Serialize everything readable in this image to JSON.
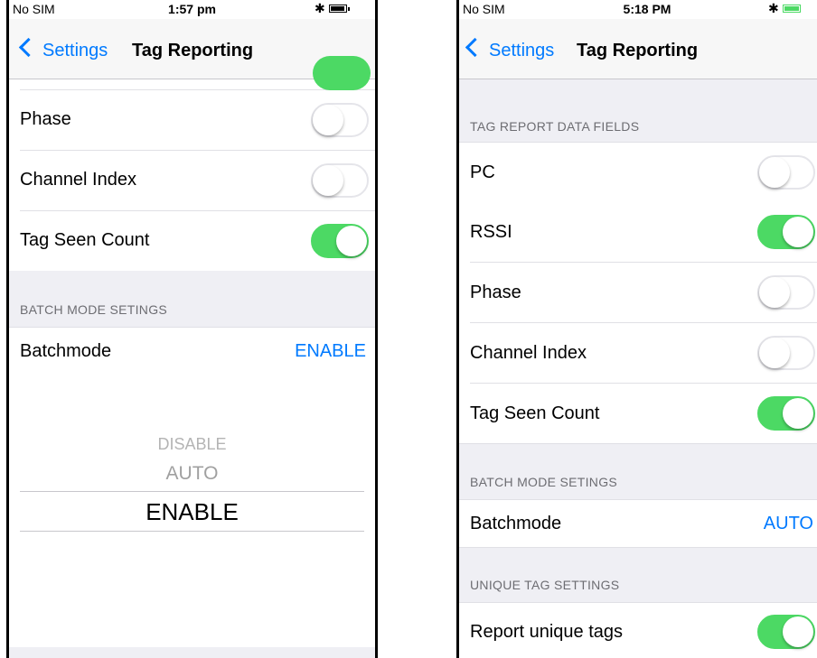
{
  "left_screen": {
    "status": {
      "carrier": "No SIM",
      "time": "1:57 pm",
      "bluetooth_icon": "bluetooth-icon",
      "battery_icon": "battery-icon"
    },
    "nav": {
      "back_label": "Settings",
      "title": "Tag Reporting"
    },
    "rows": [
      {
        "label": "Phase",
        "toggle": "off"
      },
      {
        "label": "Channel Index",
        "toggle": "off"
      },
      {
        "label": "Tag Seen Count",
        "toggle": "on"
      }
    ],
    "batch_section_header": "BATCH MODE SETINGS",
    "batchmode": {
      "label": "Batchmode",
      "value": "ENABLE"
    },
    "picker": {
      "options": [
        "DISABLE",
        "AUTO",
        "ENABLE"
      ],
      "selected": "ENABLE"
    }
  },
  "right_screen": {
    "status": {
      "carrier": "No SIM",
      "time": "5:18 PM",
      "bluetooth_icon": "bluetooth-icon",
      "battery_icon": "battery-icon"
    },
    "nav": {
      "back_label": "Settings",
      "title": "Tag Reporting"
    },
    "data_fields_header": "TAG REPORT DATA FIELDS",
    "rows": [
      {
        "label": "PC",
        "toggle": "off"
      },
      {
        "label": "RSSI",
        "toggle": "on"
      },
      {
        "label": "Phase",
        "toggle": "off"
      },
      {
        "label": "Channel Index",
        "toggle": "off"
      },
      {
        "label": "Tag Seen Count",
        "toggle": "on"
      }
    ],
    "batch_section_header": "BATCH MODE SETINGS",
    "batchmode": {
      "label": "Batchmode",
      "value": "AUTO"
    },
    "unique_section_header": "UNIQUE TAG SETTINGS",
    "unique_row": {
      "label": "Report unique tags",
      "toggle": "on"
    }
  },
  "colors": {
    "accent": "#007aff",
    "toggle_on": "#4cd964",
    "group_bg": "#efeff4",
    "header_text": "#6d6d72"
  }
}
